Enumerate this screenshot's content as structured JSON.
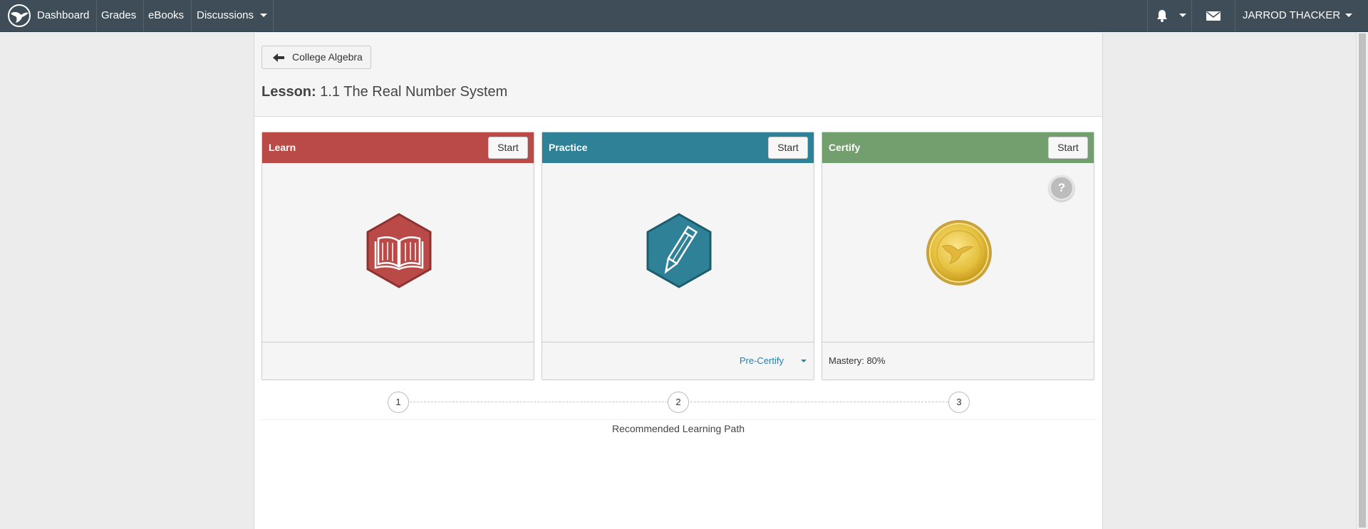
{
  "nav": {
    "items": [
      "Dashboard",
      "Grades",
      "eBooks",
      "Discussions"
    ],
    "user": "JARROD THACKER"
  },
  "header": {
    "back_label": "College Algebra",
    "lesson_prefix": "Lesson:",
    "lesson_name": "1.1 The Real Number System"
  },
  "cards": [
    {
      "title": "Learn",
      "start": "Start",
      "color": "#b94a48",
      "icon": "open-book-icon",
      "footer": ""
    },
    {
      "title": "Practice",
      "start": "Start",
      "color": "#2e8196",
      "icon": "pencil-icon",
      "footer": "Pre-Certify"
    },
    {
      "title": "Certify",
      "start": "Start",
      "color": "#739e6e",
      "icon": "gold-medal-icon",
      "footer": "Mastery: 80%",
      "help": "?"
    }
  ],
  "path": {
    "steps": [
      "1",
      "2",
      "3"
    ],
    "label": "Recommended Learning Path"
  },
  "colors": {
    "nav_bg": "#3e4d58",
    "learn": "#b94a48",
    "practice": "#2e8196",
    "certify": "#739e6e",
    "link": "#2a7fb0"
  }
}
